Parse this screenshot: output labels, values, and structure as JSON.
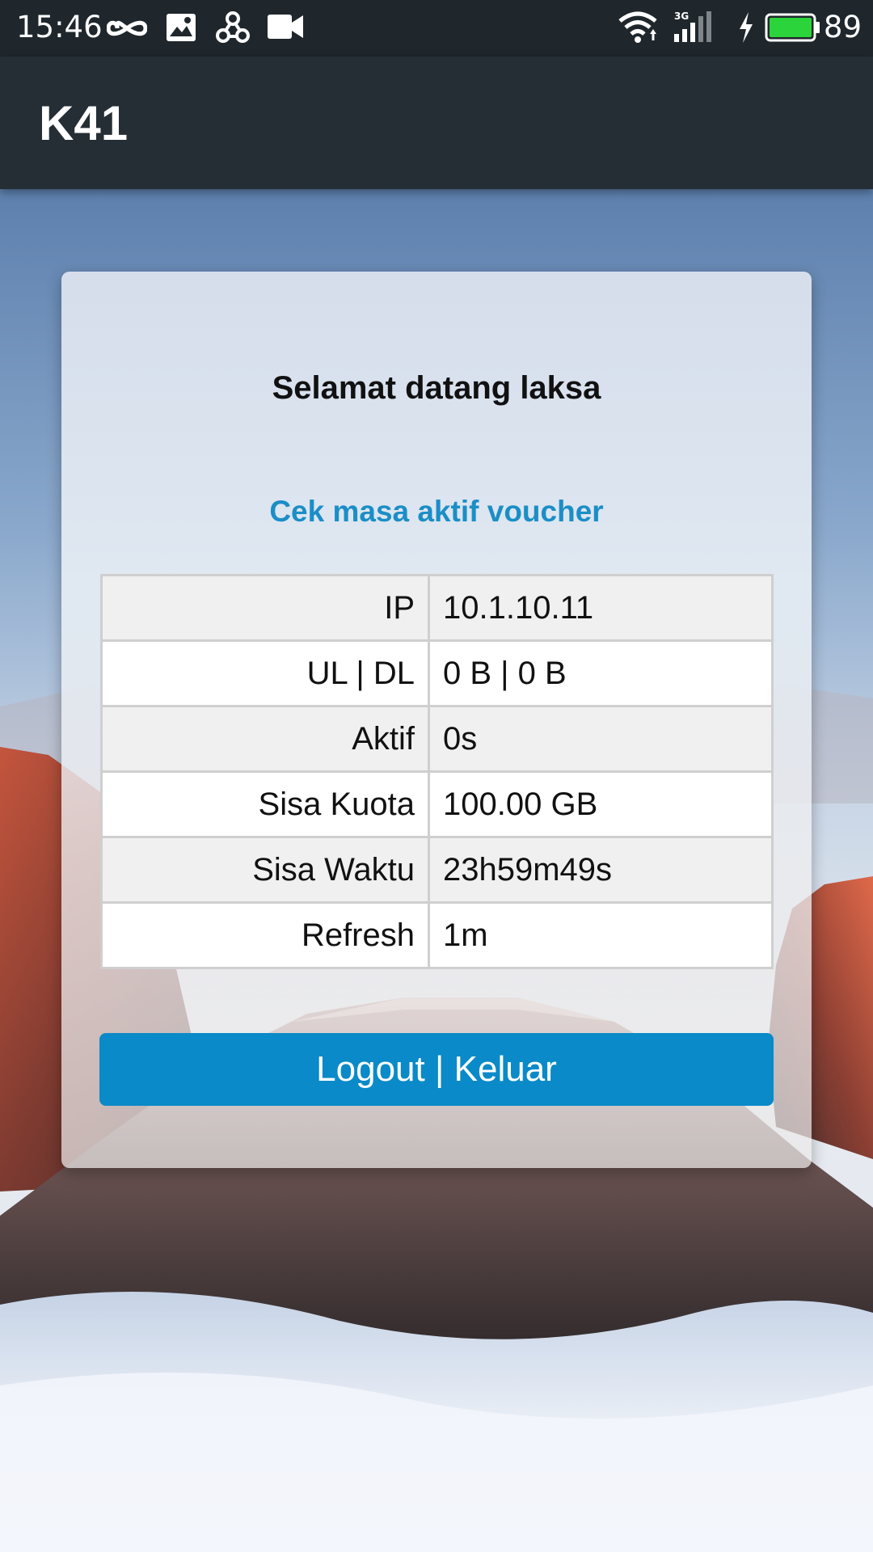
{
  "status_bar": {
    "time": "15:46",
    "network_type": "3G",
    "battery_percent": "89",
    "icons": [
      "infinity-icon",
      "image-icon",
      "share-icon",
      "video-camera-icon",
      "wifi-icon",
      "signal-icon",
      "charging-icon",
      "battery-icon"
    ],
    "battery_color": "#2bd43a"
  },
  "app_bar": {
    "title": "K41"
  },
  "card": {
    "welcome": "Selamat datang laksa",
    "voucher_link": "Cek masa aktif voucher",
    "rows": [
      {
        "label": "IP",
        "value": "10.1.10.11"
      },
      {
        "label": "UL | DL",
        "value": "0 B | 0 B"
      },
      {
        "label": "Aktif",
        "value": "0s"
      },
      {
        "label": "Sisa Kuota",
        "value": "100.00 GB"
      },
      {
        "label": "Sisa Waktu",
        "value": "23h59m49s"
      },
      {
        "label": "Refresh",
        "value": "1m"
      }
    ],
    "logout_label": "Logout | Keluar"
  },
  "colors": {
    "status_bar_bg": "#1f272c",
    "app_bar_bg": "#252e35",
    "accent": "#0a8ac8",
    "link": "#1b8ec6"
  }
}
